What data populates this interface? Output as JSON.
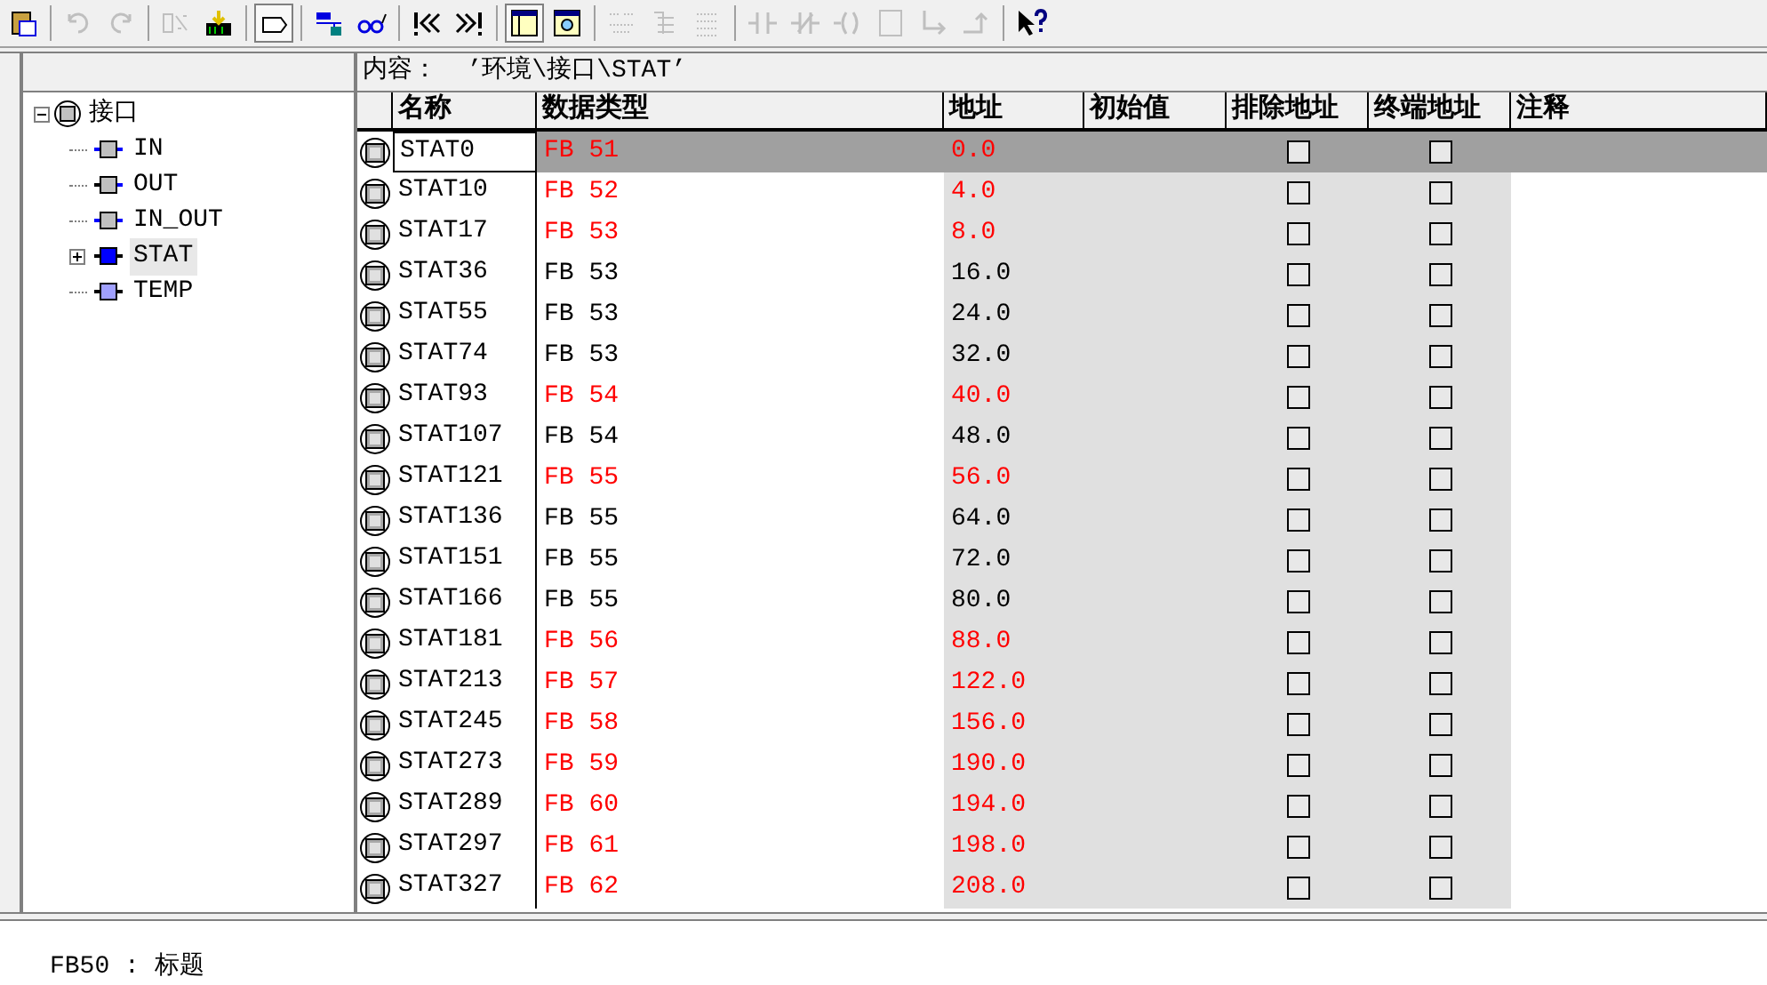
{
  "toolbar": [
    {
      "disabled": false
    },
    {
      "disabled": true
    },
    {
      "disabled": true
    },
    {
      "disabled": true
    },
    {
      "disabled": false
    },
    {
      "disabled": false,
      "pressed": true
    },
    {
      "disabled": false
    },
    {
      "disabled": false
    },
    {
      "disabled": false
    },
    {
      "disabled": false
    },
    {
      "disabled": false,
      "pressed": true
    },
    {
      "disabled": false
    },
    {
      "disabled": true
    },
    {
      "disabled": true
    },
    {
      "disabled": true
    },
    {
      "disabled": true
    },
    {
      "disabled": true
    },
    {
      "disabled": true
    },
    {
      "disabled": true
    },
    {
      "disabled": true
    },
    {
      "disabled": true
    },
    {
      "disabled": false
    }
  ],
  "tree": {
    "label": "接口",
    "expanded": true,
    "children": [
      {
        "label": "IN",
        "kind": "in",
        "selected": false
      },
      {
        "label": "OUT",
        "kind": "out",
        "selected": false
      },
      {
        "label": "IN_OUT",
        "kind": "inout",
        "selected": false
      },
      {
        "label": "STAT",
        "kind": "stat",
        "selected": true,
        "expanded": false
      },
      {
        "label": "TEMP",
        "kind": "temp",
        "selected": false
      }
    ]
  },
  "content_path": "内容：  ’环境\\接口\\STAT’",
  "table": {
    "columns": [
      "名称",
      "数据类型",
      "地址",
      "初始值",
      "排除地址",
      "终端地址",
      "注释"
    ],
    "rows": [
      {
        "name": "STAT0",
        "type": "FB 51",
        "address": "0.0",
        "changed": true,
        "selected": true,
        "excluded": false,
        "terminal": false
      },
      {
        "name": "STAT10",
        "type": "FB 52",
        "address": "4.0",
        "changed": true,
        "selected": false,
        "excluded": false,
        "terminal": false
      },
      {
        "name": "STAT17",
        "type": "FB 53",
        "address": "8.0",
        "changed": true,
        "selected": false,
        "excluded": false,
        "terminal": false
      },
      {
        "name": "STAT36",
        "type": "FB 53",
        "address": "16.0",
        "changed": false,
        "selected": false,
        "excluded": false,
        "terminal": false
      },
      {
        "name": "STAT55",
        "type": "FB 53",
        "address": "24.0",
        "changed": false,
        "selected": false,
        "excluded": false,
        "terminal": false
      },
      {
        "name": "STAT74",
        "type": "FB 53",
        "address": "32.0",
        "changed": false,
        "selected": false,
        "excluded": false,
        "terminal": false
      },
      {
        "name": "STAT93",
        "type": "FB 54",
        "address": "40.0",
        "changed": true,
        "selected": false,
        "excluded": false,
        "terminal": false
      },
      {
        "name": "STAT107",
        "type": "FB 54",
        "address": "48.0",
        "changed": false,
        "selected": false,
        "excluded": false,
        "terminal": false
      },
      {
        "name": "STAT121",
        "type": "FB 55",
        "address": "56.0",
        "changed": true,
        "selected": false,
        "excluded": false,
        "terminal": false
      },
      {
        "name": "STAT136",
        "type": "FB 55",
        "address": "64.0",
        "changed": false,
        "selected": false,
        "excluded": false,
        "terminal": false
      },
      {
        "name": "STAT151",
        "type": "FB 55",
        "address": "72.0",
        "changed": false,
        "selected": false,
        "excluded": false,
        "terminal": false
      },
      {
        "name": "STAT166",
        "type": "FB 55",
        "address": "80.0",
        "changed": false,
        "selected": false,
        "excluded": false,
        "terminal": false
      },
      {
        "name": "STAT181",
        "type": "FB 56",
        "address": "88.0",
        "changed": true,
        "selected": false,
        "excluded": false,
        "terminal": false
      },
      {
        "name": "STAT213",
        "type": "FB 57",
        "address": "122.0",
        "changed": true,
        "selected": false,
        "excluded": false,
        "terminal": false
      },
      {
        "name": "STAT245",
        "type": "FB 58",
        "address": "156.0",
        "changed": true,
        "selected": false,
        "excluded": false,
        "terminal": false
      },
      {
        "name": "STAT273",
        "type": "FB 59",
        "address": "190.0",
        "changed": true,
        "selected": false,
        "excluded": false,
        "terminal": false
      },
      {
        "name": "STAT289",
        "type": "FB 60",
        "address": "194.0",
        "changed": true,
        "selected": false,
        "excluded": false,
        "terminal": false
      },
      {
        "name": "STAT297",
        "type": "FB 61",
        "address": "198.0",
        "changed": true,
        "selected": false,
        "excluded": false,
        "terminal": false
      },
      {
        "name": "STAT327",
        "type": "FB 62",
        "address": "208.0",
        "changed": true,
        "selected": false,
        "excluded": false,
        "terminal": false
      }
    ]
  },
  "bottom_title": "FB50 : 标题"
}
